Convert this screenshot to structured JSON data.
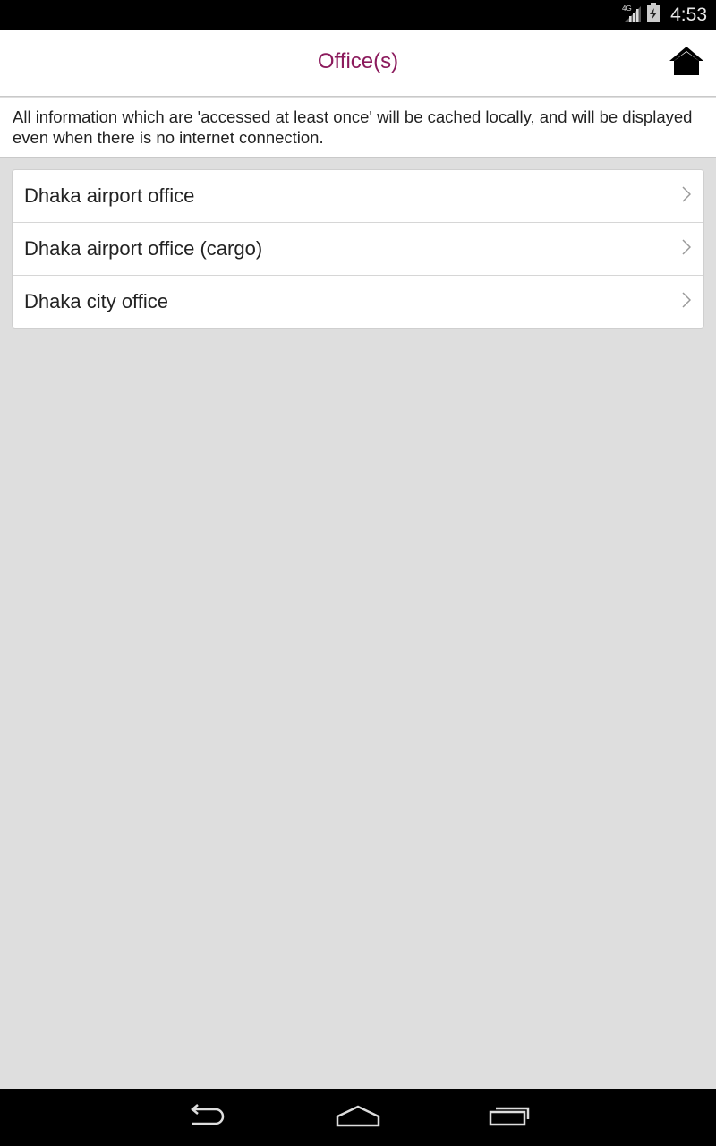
{
  "status_bar": {
    "network": "4G",
    "time": "4:53",
    "icons": [
      "signal-icon",
      "battery-charging-icon"
    ]
  },
  "header": {
    "title": "Office(s)",
    "title_color": "#8b1a5c",
    "home_icon": "home-icon"
  },
  "info": {
    "text": "All information which are 'accessed at least once' will be cached locally, and will be displayed even when there is no internet connection."
  },
  "offices": [
    {
      "label": "Dhaka airport office"
    },
    {
      "label": "Dhaka airport office (cargo)"
    },
    {
      "label": "Dhaka city office"
    }
  ],
  "nav_bar": {
    "icons": [
      "back-icon",
      "home-nav-icon",
      "recents-icon"
    ]
  }
}
